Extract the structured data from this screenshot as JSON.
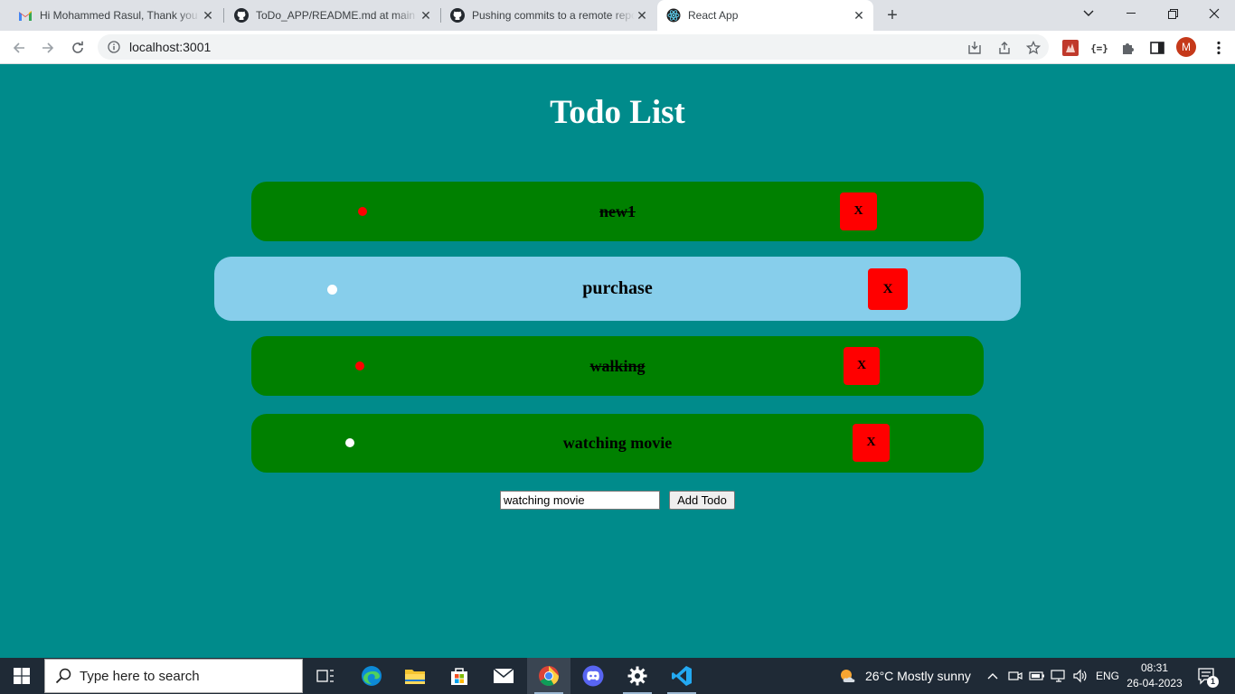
{
  "browser": {
    "tabs": [
      {
        "title": "Hi Mohammed Rasul, Thank you for",
        "icon": "gmail-icon",
        "active": false
      },
      {
        "title": "ToDo_APP/README.md at main · ",
        "icon": "github-icon",
        "active": false
      },
      {
        "title": "Pushing commits to a remote repository",
        "icon": "github-icon",
        "active": false
      },
      {
        "title": "React App",
        "icon": "react-icon",
        "active": true
      }
    ],
    "url": "localhost:3001",
    "profile_initial": "M"
  },
  "app": {
    "title": "Todo List",
    "todos": [
      {
        "text": "new1",
        "completed": true
      },
      {
        "text": "purchase",
        "completed": false
      },
      {
        "text": "walking",
        "completed": true
      },
      {
        "text": "watching movie",
        "completed": false
      }
    ],
    "delete_label": "X",
    "input_value": "watching movie",
    "add_button_label": "Add Todo",
    "colors": {
      "background": "#008b8b",
      "todo_bg": "#008000",
      "todo_hover_bg": "#87ceeb",
      "delete_bg": "#ff0000",
      "completed_dot": "#ff0000",
      "open_dot": "#ffffff"
    }
  },
  "taskbar": {
    "search_placeholder": "Type here to search",
    "weather": "26°C  Mostly sunny",
    "language": "ENG",
    "time": "08:31",
    "date": "26-04-2023",
    "notification_count": "1"
  }
}
